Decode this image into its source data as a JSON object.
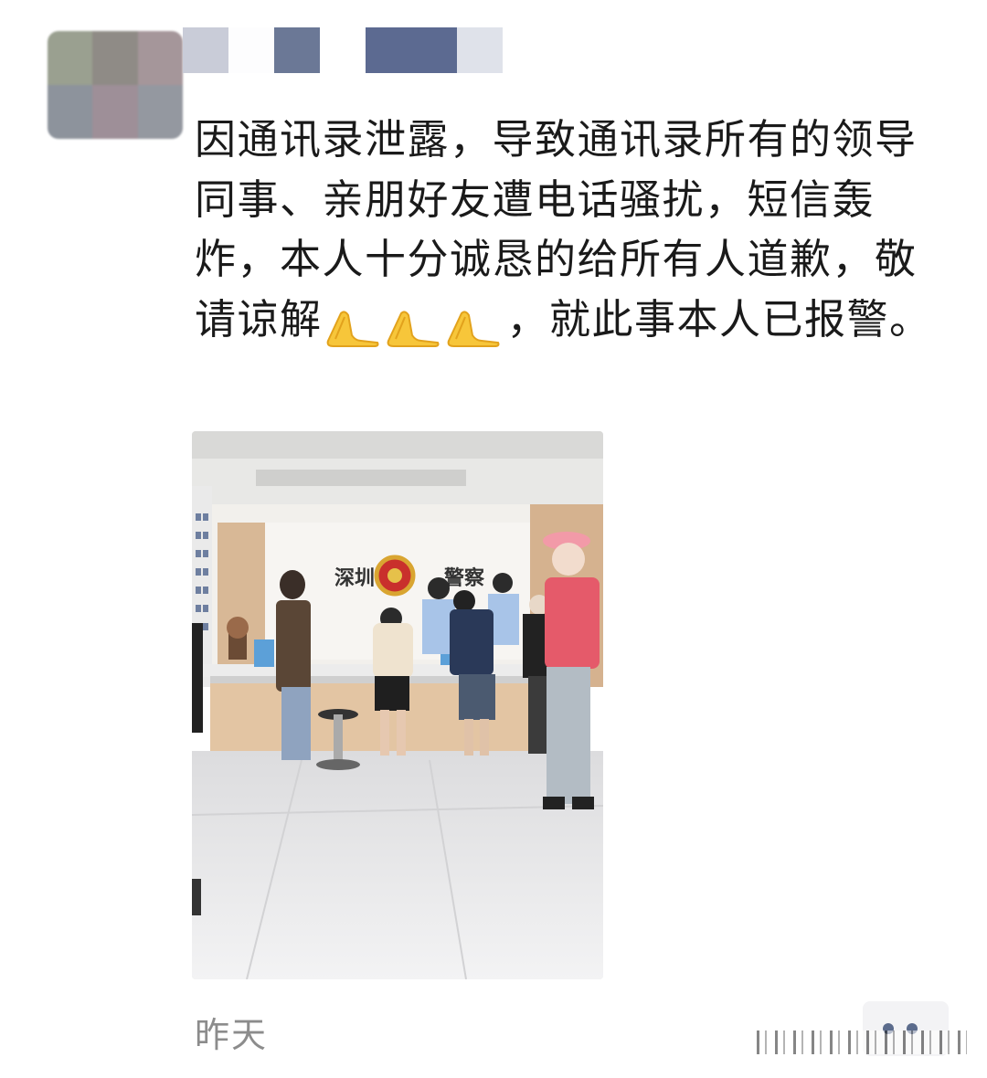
{
  "post": {
    "text_before_emoji": "因通讯录泄露，导致通讯录所有的领导同事、亲朋好友遭电话骚扰，短信轰炸，本人十分诚恳的给所有人道歉，敬请谅解",
    "emoji": "folded-hands-icon x3",
    "text_after_emoji": "，就此事本人已报警。",
    "timestamp": "昨天"
  },
  "photo": {
    "sign_left": "深圳",
    "sign_right": "警察"
  },
  "colors": {
    "text": "#1a1a1a",
    "timestamp": "#8c8c8c",
    "more_button_bg": "#f3f3f5",
    "more_dots": "#5b6b8c"
  }
}
